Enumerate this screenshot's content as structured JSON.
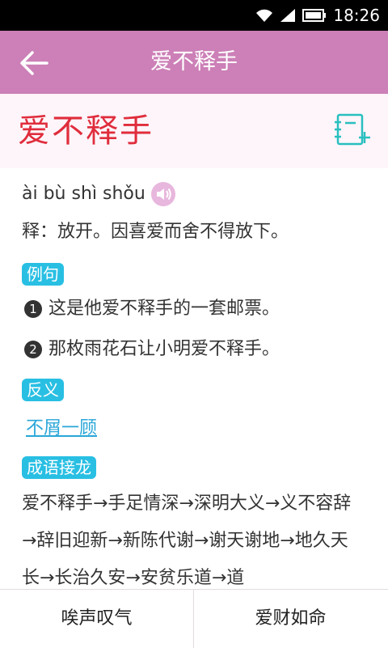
{
  "status_bar": {
    "time": "18:26",
    "icons": [
      "wifi-icon",
      "signal-icon",
      "battery-icon"
    ]
  },
  "app_bar": {
    "title": "爱不释手",
    "back_icon": "back-arrow-icon"
  },
  "entry": {
    "headword": "爱不释手",
    "pinyin": "ài bù shì shǒu",
    "definition": "释：放开。因喜爱而舍不得放下。",
    "add_note_icon": "add-note-icon",
    "speaker_icon": "speaker-icon"
  },
  "sections": {
    "examples": {
      "label": "例句",
      "items": [
        {
          "num": "1",
          "text": "这是他爱不释手的一套邮票。"
        },
        {
          "num": "2",
          "text": "那枚雨花石让小明爱不释手。"
        }
      ]
    },
    "antonym": {
      "label": "反义",
      "link": "不屑一顾"
    },
    "chain": {
      "label": "成语接龙",
      "text": "爱不释手→手足情深→深明大义→义不容辞→辞旧迎新→新陈代谢→谢天谢地→地久天长→长治久安→安贫乐道→道"
    }
  },
  "bottom_bar": {
    "prev": "唉声叹气",
    "next": "爱财如命"
  },
  "colors": {
    "app_bar": "#cc80b7",
    "headword": "#e02d3c",
    "tag": "#29bfe3",
    "link": "#29a6d8",
    "add_note_icon": "#29bfbf",
    "speaker_icon": "#e8b7dd"
  }
}
